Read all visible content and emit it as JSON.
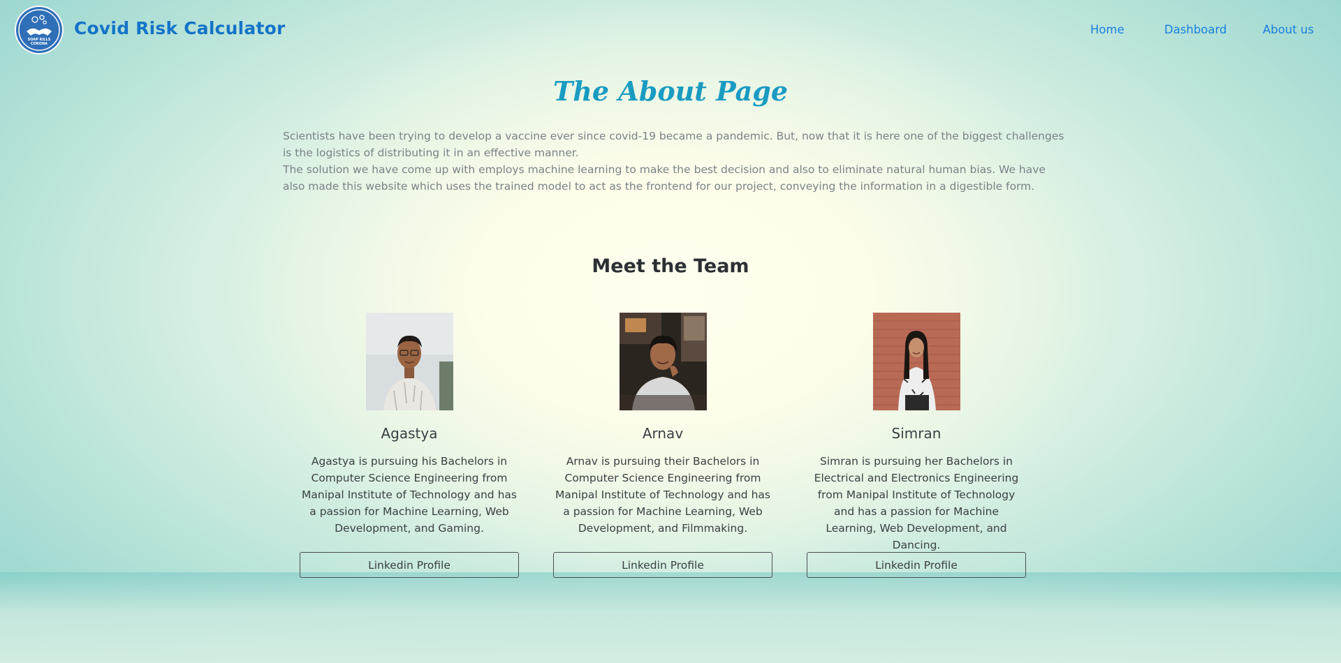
{
  "navbar": {
    "brand": "Covid Risk Calculator",
    "logo_text": "SOAP KILLS CORONA",
    "links": [
      {
        "label": "Home"
      },
      {
        "label": "Dashboard"
      },
      {
        "label": "About us"
      }
    ],
    "link_color": "#1a7fe0",
    "brand_color": "#1574c8"
  },
  "about": {
    "title": "The About Page",
    "paragraphs": [
      "Scientists have been trying to develop a vaccine ever since covid-19 became a pandemic. But, now that it is here one of the biggest challenges is the logistics of distributing it in an effective manner.",
      "The solution we have come up with employs machine learning to make the best decision and also to eliminate natural human bias. We have also made this website which uses the trained model to act as the frontend for our project, conveying the information in a digestible form."
    ],
    "title_color": "#1a9bc2"
  },
  "team": {
    "title": "Meet the Team",
    "members": [
      {
        "name": "Agastya",
        "bio": "Agastya is pursuing his Bachelors in Computer Science Engineering from Manipal Institute of Technology and has a passion for Machine Learning, Web Development, and Gaming.",
        "button": "Linkedin Profile"
      },
      {
        "name": "Arnav",
        "bio": "Arnav is pursuing their Bachelors in Computer Science Engineering from Manipal Institute of Technology and has a passion for Machine Learning, Web Development, and Filmmaking.",
        "button": "Linkedin Profile"
      },
      {
        "name": "Simran",
        "bio": "Simran is pursuing her Bachelors in Electrical and Electronics Engineering from Manipal Institute of Technology and has a passion for Machine Learning, Web Development, and Dancing.",
        "button": "Linkedin Profile"
      }
    ]
  }
}
